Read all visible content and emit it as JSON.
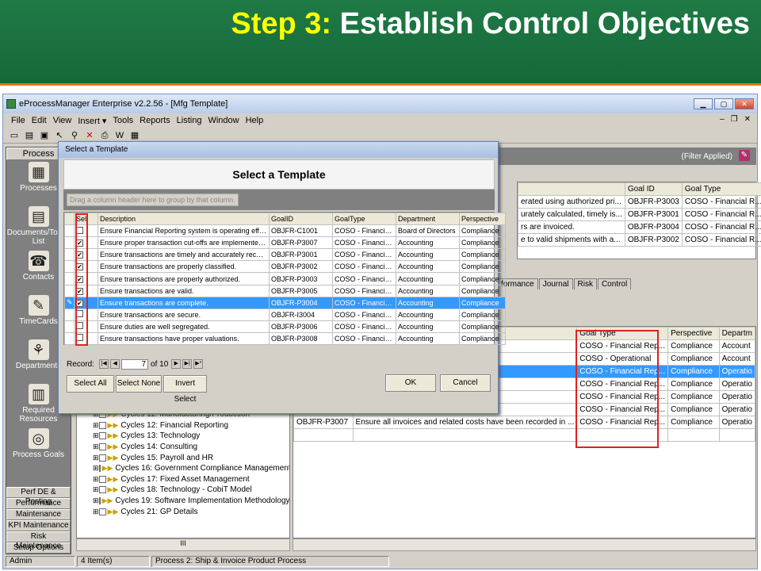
{
  "slide": {
    "title_step": "Step 3:",
    "title_rest": "Establish Control Objectives"
  },
  "app": {
    "title": "eProcessManager Enterprise v2.2.56 - [Mfg Template]",
    "menu": [
      "File",
      "Edit",
      "View",
      "Insert ▾",
      "Tools",
      "Reports",
      "Listing",
      "Window",
      "Help"
    ],
    "filter_text": "(Filter Applied)"
  },
  "sidebar": {
    "header": "Process",
    "items": [
      "Processes",
      "Documents/To Do List",
      "Contacts",
      "TimeCards",
      "Departments",
      "Required Resources",
      "Process Goals"
    ],
    "bottom": [
      "Perf DE & Posting",
      "Performance",
      "Maintenance",
      "KPI Maintenance",
      "Risk Maintenance",
      "Setup Options"
    ]
  },
  "topgrid": {
    "columns": [
      "",
      "Goal ID",
      "Goal Type"
    ],
    "rows": [
      [
        "erated using authorized pri...",
        "OBJFR-P3003",
        "COSO - Financial R..."
      ],
      [
        "urately calculated, timely is...",
        "OBJFR-P3001",
        "COSO - Financial R..."
      ],
      [
        "rs are invoiced.",
        "OBJFR-P3004",
        "COSO - Financial R..."
      ],
      [
        "e to valid shipments with a...",
        "OBJFR-P3002",
        "COSO - Financial R..."
      ]
    ]
  },
  "tabs": [
    "formance",
    "Journal",
    "Risk",
    "Control"
  ],
  "tree": {
    "items": [
      "Cycles 11: Manufacturing/Production",
      "Cycles 12: Financial Reporting",
      "Cycles 13: Technology",
      "Cycles 14: Consulting",
      "Cycles 15: Payroll and HR",
      "Cycles 16: Government Compliance Management",
      "Cycles 17: Fixed Asset Management",
      "Cycles 18: Technology - CobiT Model",
      "Cycles 19: Software Implementation Methodology",
      "Cycles 21: GP Details"
    ],
    "scroll_label": "III"
  },
  "biggrid": {
    "columns": [
      "",
      "",
      "Goal Type",
      "Perspective",
      "Departm"
    ],
    "rows": [
      [
        "",
        "rately shipped.",
        "COSO - Financial Rep...",
        "Compliance",
        "Account"
      ],
      [
        "",
        "",
        "COSO - Operational",
        "Compliance",
        "Account"
      ],
      [
        "",
        "ed, timely issued and ...",
        "COSO - Financial Rep...",
        "Compliance",
        "Operatio"
      ],
      [
        "",
        "ents with appropriate ...",
        "COSO - Financial Rep...",
        "Compliance",
        "Operatio"
      ],
      [
        "",
        "thorized pricing.",
        "COSO - Financial Rep...",
        "Compliance",
        "Operatio"
      ],
      [
        "OBJFR-P3004",
        "Ensure all shipped orders are invoiced.",
        "COSO - Financial Rep...",
        "Compliance",
        "Operatio"
      ],
      [
        "OBJFR-P3007",
        "Ensure all invoices and related costs have been recorded in ...",
        "COSO - Financial Rep...",
        "Compliance",
        "Operatio"
      ],
      [
        "",
        "",
        "",
        "",
        ""
      ]
    ],
    "new_row_marker": "✳"
  },
  "status": [
    "Admin",
    "4 Item(s)",
    "Process 2: Ship & Invoice Product Process"
  ],
  "dialog": {
    "title": "Select a Template",
    "heading": "Select a Template",
    "drag_hint": "Drag a column header here to group by that column.",
    "columns": [
      "Sel",
      "Description",
      "GoalID",
      "GoalType",
      "Department",
      "Perspective"
    ],
    "rows": [
      {
        "checked": false,
        "desc": "Ensure Financial Reporting system is operating effectiv...",
        "id": "OBJFR-C1001",
        "type": "COSO - Financial ...",
        "dept": "Board of Directors",
        "persp": "Compliance",
        "selected": false
      },
      {
        "checked": true,
        "desc": "Ensure proper transaction cut-offs are implemented at ...",
        "id": "OBJFR-P3007",
        "type": "COSO - Financial ...",
        "dept": "Accounting",
        "persp": "Compliance",
        "selected": false
      },
      {
        "checked": true,
        "desc": "Ensure transactions are timely and accurately recorded.",
        "id": "OBJFR-P3001",
        "type": "COSO - Financial ...",
        "dept": "Accounting",
        "persp": "Compliance",
        "selected": false
      },
      {
        "checked": true,
        "desc": "Ensure transactions are properly classified.",
        "id": "OBJFR-P3002",
        "type": "COSO - Financial ...",
        "dept": "Accounting",
        "persp": "Compliance",
        "selected": false
      },
      {
        "checked": true,
        "desc": "Ensure transactions are properly authorized.",
        "id": "OBJFR-P3003",
        "type": "COSO - Financial ...",
        "dept": "Accounting",
        "persp": "Compliance",
        "selected": false
      },
      {
        "checked": true,
        "desc": "Ensure transactions are valid.",
        "id": "OBJFR-P3005",
        "type": "COSO - Financial ...",
        "dept": "Accounting",
        "persp": "Compliance",
        "selected": false
      },
      {
        "checked": true,
        "desc": "Ensure transactions are complete.",
        "id": "OBJFR-P3004",
        "type": "COSO - Financial ...",
        "dept": "Accounting",
        "persp": "Compliance",
        "selected": true
      },
      {
        "checked": false,
        "desc": "Ensure transactions are secure.",
        "id": "OBJFR-I3004",
        "type": "COSO - Financial ...",
        "dept": "Accounting",
        "persp": "Compliance",
        "selected": false
      },
      {
        "checked": false,
        "desc": "Ensure duties are well segregated.",
        "id": "OBJFR-P3006",
        "type": "COSO - Financial ...",
        "dept": "Accounting",
        "persp": "Compliance",
        "selected": false
      },
      {
        "checked": false,
        "desc": "Ensure transactions have proper valuations.",
        "id": "OBJFR-P3008",
        "type": "COSO - Financial ...",
        "dept": "Accounting",
        "persp": "Compliance",
        "selected": false
      }
    ],
    "record_label": "Record:",
    "record_current": "7",
    "record_total": "of 10",
    "buttons": {
      "select_all": "Select All",
      "select_none": "Select None",
      "invert": "Invert Select",
      "ok": "OK",
      "cancel": "Cancel"
    }
  }
}
